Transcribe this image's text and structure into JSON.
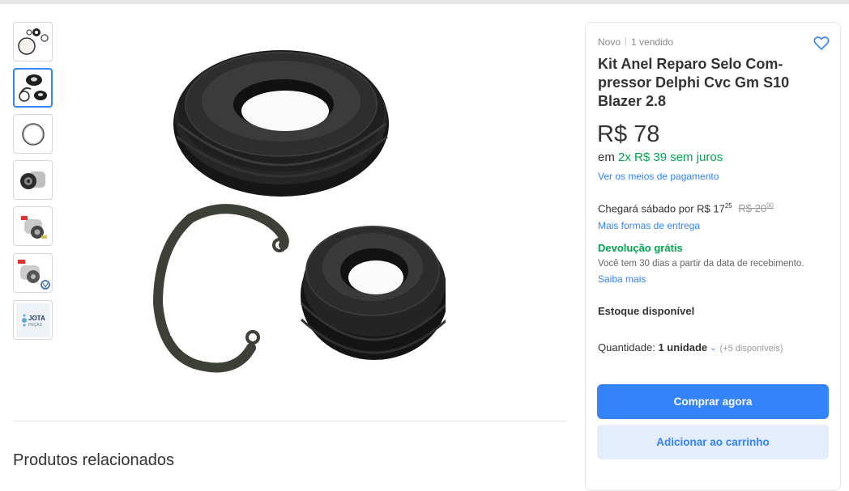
{
  "gallery": {
    "thumbnails": [
      {
        "alt": "kit-overview"
      },
      {
        "alt": "seals-and-rings",
        "active": true
      },
      {
        "alt": "ring"
      },
      {
        "alt": "compressor-front"
      },
      {
        "alt": "compressor-side"
      },
      {
        "alt": "compressor-vw"
      },
      {
        "alt": "brand-logo",
        "text": "JOTA",
        "subtext": "PEÇAS"
      }
    ]
  },
  "product": {
    "condition": "Novo",
    "sold": "1 vendido",
    "title": "Kit Anel Reparo Selo Com-pressor Delphi Cvc Gm S10 Blazer 2.8",
    "price": "R$ 78",
    "installments_prefix": "em",
    "installments_value": "2x R$ 39 sem juros",
    "payment_link": "Ver os meios de pagamento",
    "shipping_text": "Chegará sábado por R$ 17",
    "shipping_cents": "25",
    "shipping_old": "R$ 20",
    "shipping_old_cents": "90",
    "shipping_link": "Mais formas de entrega",
    "returns_title": "Devolução grátis",
    "returns_text": "Você tem 30 dias a partir da data de recebimento.",
    "returns_link": "Saiba mais",
    "stock": "Estoque disponível",
    "quantity_label": "Quantidade:",
    "quantity_value": "1 unidade",
    "quantity_available": "(+5 disponíveis)",
    "buy_button": "Comprar agora",
    "cart_button": "Adicionar ao carrinho"
  },
  "related": {
    "title": "Produtos relacionados"
  },
  "colors": {
    "accent": "#3483fa",
    "green": "#00a650",
    "cart_bg": "#e3edfb"
  },
  "icons": {
    "favorite": "heart-icon",
    "quantity_dropdown": "chevron-down-icon"
  }
}
